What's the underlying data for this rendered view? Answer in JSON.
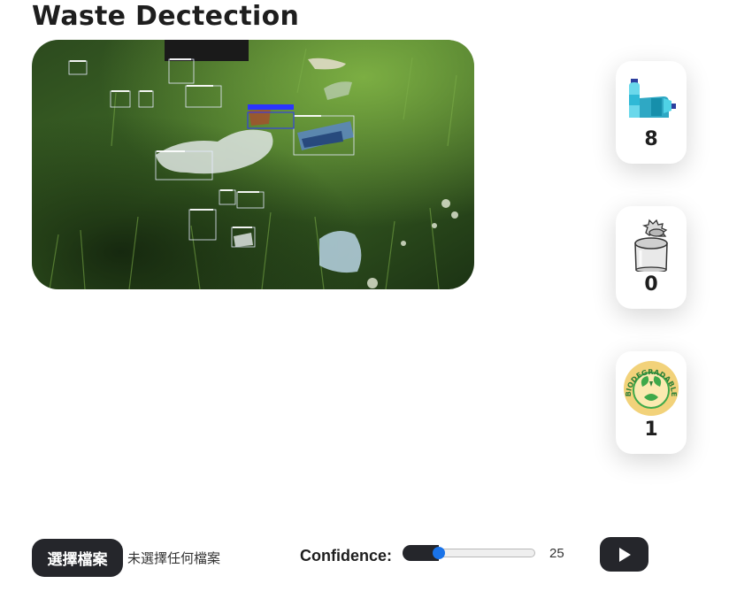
{
  "page": {
    "title": "Waste Dectection"
  },
  "counts": {
    "plastic": {
      "icon": "plastic-bottles-icon",
      "value": "8"
    },
    "metal": {
      "icon": "tin-can-icon",
      "value": "0"
    },
    "biodegradable": {
      "icon": "biodegradable-badge-icon",
      "value": "1",
      "badge_text": "BIODEGRADABLE"
    }
  },
  "controls": {
    "file_button_label": "選擇檔案",
    "file_status": "未選擇任何檔案",
    "confidence_label": "Confidence:",
    "confidence_value": "25",
    "confidence_fraction": 0.25,
    "play_icon": "play-icon"
  },
  "colors": {
    "dark_button": "#25262b",
    "slider_thumb": "#1a73e8",
    "bottle_cyan": "#4fd2e6",
    "bio_green": "#3ea94a",
    "bio_badge": "#f2d27a"
  }
}
